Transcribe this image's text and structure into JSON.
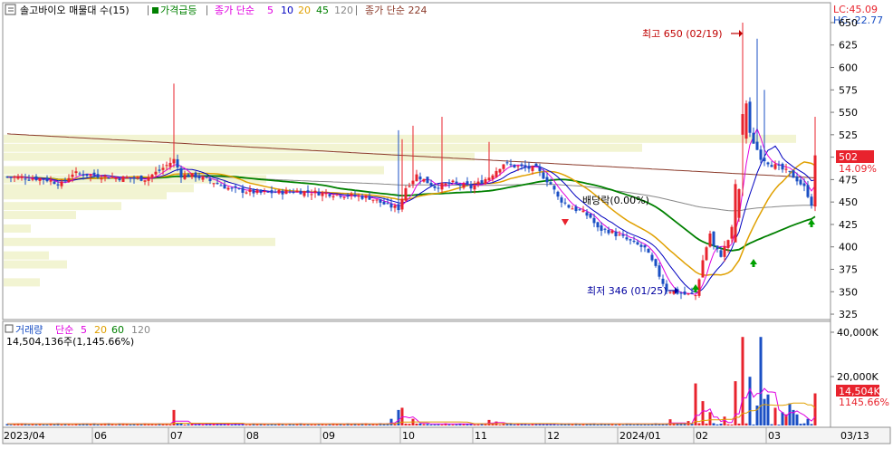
{
  "legend": {
    "title": "솔고바이오 매물대 수(15)",
    "item_price_surge": "가격급등",
    "ma_label": "종가 단순",
    "ma_periods": [
      "5",
      "10",
      "20",
      "45",
      "120"
    ],
    "ma_colors": [
      "#e000e0",
      "#0000c0",
      "#e0a000",
      "#008000",
      "#888888"
    ],
    "long_ma_label": "종가 단순 224",
    "long_ma_color": "#8b3a2a"
  },
  "topright": {
    "lc": "LC:45.09",
    "hc": "HC:-22.77"
  },
  "price_axis": {
    "ticks": [
      "650",
      "625",
      "600",
      "575",
      "550",
      "525",
      "500",
      "475",
      "450",
      "425",
      "400",
      "375",
      "350",
      "325"
    ],
    "current_value": "502",
    "current_change": "14.09%"
  },
  "annotations": {
    "high": "최고 650 (02/19)",
    "low": "최저 346 (01/25)",
    "dividend": "배당락(0.00%)"
  },
  "volume_legend": {
    "title": "거래량",
    "ma_label": "단순",
    "periods": [
      "5",
      "20",
      "60",
      "120"
    ],
    "value_line": "14,504,136주(1,145.66%)"
  },
  "volume_axis": {
    "ticks": [
      "40,000K",
      "20,000K"
    ],
    "current_value": "14,504K",
    "current_pct": "1145.66%"
  },
  "x_axis": {
    "labels": [
      "2023/04",
      "06",
      "07",
      "08",
      "09",
      "10",
      "11",
      "12",
      "2024/01",
      "02",
      "03",
      "03/13"
    ]
  },
  "colors": {
    "up": "#e8232d",
    "down": "#1a4fc4",
    "ma5": "#e000e0",
    "ma10": "#0000c0",
    "ma20": "#e0a000",
    "ma45": "#008000",
    "ma120": "#888888",
    "ma224": "#8b3a2a",
    "profile": "#f2f4d2"
  },
  "chart_data": {
    "type": "candlestick",
    "ylim": [
      320,
      655
    ],
    "volume_ylim": [
      0,
      45000
    ],
    "months": [
      "2023/04",
      "06",
      "07",
      "08",
      "09",
      "10",
      "11",
      "12",
      "2024/01",
      "02",
      "03"
    ],
    "month_bars": [
      0,
      25,
      46,
      67,
      88,
      110,
      130,
      150,
      170,
      191,
      211
    ],
    "keypoints": [
      [
        0,
        478
      ],
      [
        10,
        476
      ],
      [
        15,
        470
      ],
      [
        18,
        482
      ],
      [
        24,
        480
      ],
      [
        30,
        477
      ],
      [
        38,
        476
      ],
      [
        42,
        485
      ],
      [
        46,
        497
      ],
      [
        48,
        480
      ],
      [
        52,
        479
      ],
      [
        57,
        472
      ],
      [
        62,
        464
      ],
      [
        70,
        460
      ],
      [
        80,
        462
      ],
      [
        90,
        459
      ],
      [
        100,
        455
      ],
      [
        105,
        446
      ],
      [
        108,
        443
      ],
      [
        110,
        466
      ],
      [
        113,
        480
      ],
      [
        118,
        467
      ],
      [
        123,
        471
      ],
      [
        128,
        466
      ],
      [
        133,
        478
      ],
      [
        137,
        493
      ],
      [
        140,
        490
      ],
      [
        143,
        488
      ],
      [
        146,
        487
      ],
      [
        150,
        470
      ],
      [
        152,
        455
      ],
      [
        155,
        445
      ],
      [
        158,
        440
      ],
      [
        161,
        433
      ],
      [
        163,
        420
      ],
      [
        166,
        418
      ],
      [
        170,
        410
      ],
      [
        174,
        402
      ],
      [
        176,
        398
      ],
      [
        179,
        376
      ],
      [
        182,
        352
      ],
      [
        185,
        349
      ],
      [
        187,
        347
      ],
      [
        190,
        346
      ],
      [
        192,
        385
      ],
      [
        194,
        415
      ],
      [
        195,
        400
      ],
      [
        197,
        391
      ],
      [
        199,
        408
      ],
      [
        201,
        432
      ],
      [
        202,
        462
      ],
      [
        203,
        520
      ],
      [
        204,
        560
      ],
      [
        205,
        525
      ],
      [
        208,
        500
      ],
      [
        211,
        492
      ],
      [
        214,
        486
      ],
      [
        216,
        482
      ],
      [
        218,
        475
      ],
      [
        220,
        466
      ],
      [
        221,
        458
      ],
      [
        222,
        448
      ],
      [
        223,
        502
      ]
    ],
    "max_high": {
      "date": "02/19",
      "value": 650
    },
    "min_low": {
      "date": "01/25",
      "value": 346
    },
    "last_close": 502,
    "last_change_pct": 14.09,
    "volume_spikes": [
      [
        46,
        7000
      ],
      [
        106,
        3000
      ],
      [
        108,
        7000
      ],
      [
        109,
        8000
      ],
      [
        112,
        3000
      ],
      [
        133,
        2500
      ],
      [
        135,
        1800
      ],
      [
        183,
        2800
      ],
      [
        188,
        2000
      ],
      [
        190,
        19000
      ],
      [
        192,
        11000
      ],
      [
        194,
        6000
      ],
      [
        198,
        4000
      ],
      [
        201,
        20000
      ],
      [
        203,
        40000
      ],
      [
        205,
        22000
      ],
      [
        207,
        9000
      ],
      [
        208,
        40000
      ],
      [
        209,
        12000
      ],
      [
        210,
        14000
      ],
      [
        212,
        8000
      ],
      [
        214,
        6000
      ],
      [
        215,
        5000
      ],
      [
        216,
        10000
      ],
      [
        217,
        7000
      ],
      [
        218,
        5000
      ],
      [
        221,
        3000
      ],
      [
        223,
        14504
      ]
    ],
    "volume_base": 700,
    "last_volume": "14,504,136"
  }
}
